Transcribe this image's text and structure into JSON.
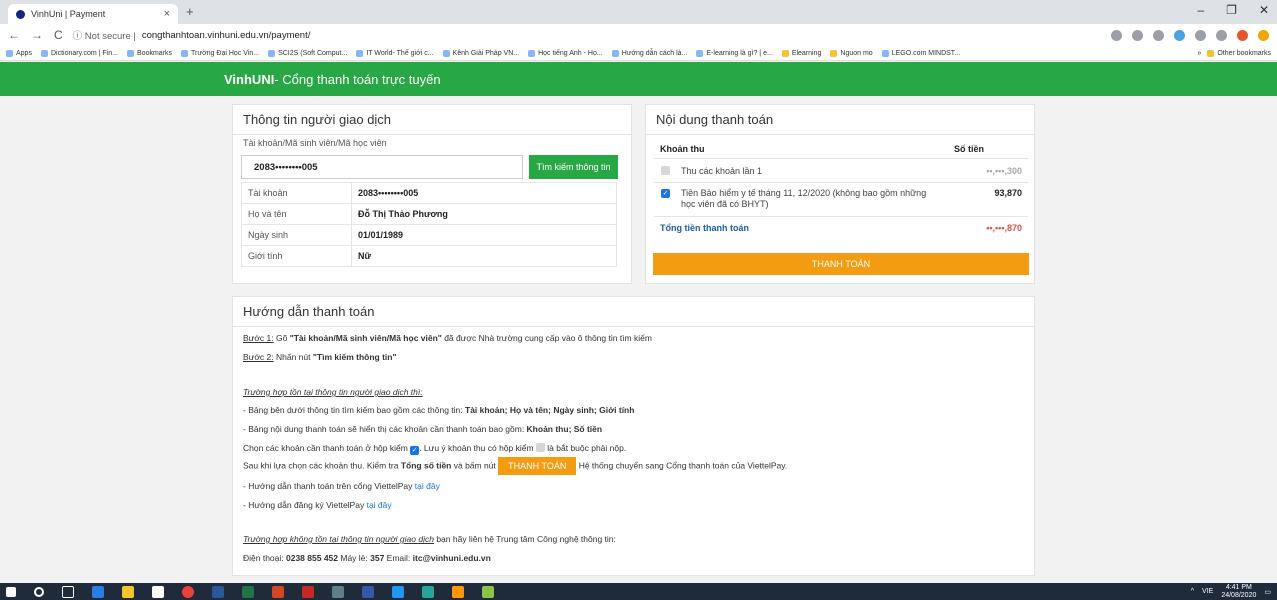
{
  "browser": {
    "tab_title": "VinhUni | Payment",
    "tab_close": "×",
    "new_tab": "+",
    "win_min": "–",
    "win_max": "❐",
    "win_close": "✕",
    "nav_back": "←",
    "nav_forward": "→",
    "nav_reload": "C",
    "security": "ⓘ Not secure |",
    "url": "congthanhtoan.vinhuni.edu.vn/payment/"
  },
  "bookmarks": {
    "items": [
      "Apps",
      "Dictionary.com | Fin...",
      "Bookmarks",
      "Trường Đại Học Vin...",
      "SCI2S (Soft Comput...",
      "IT World- Thế giới c...",
      "Kênh Giải Pháp VN...",
      "Học tiếng Anh - Họ...",
      "Hướng dẫn cách là...",
      "E-learning là gì? | e...",
      "Elearning",
      "Nguon mo",
      "LEGO.com MINDST..."
    ],
    "more": "»",
    "other": "Other bookmarks"
  },
  "header": {
    "brand": "VinhUNI",
    "title": " - Cổng thanh toán trực tuyến"
  },
  "user_panel": {
    "title": "Thông tin người giao dịch",
    "account_label": "Tài khoản/Mã sinh viên/Mã học viên",
    "account_value": "2083••••••••005",
    "search_button": "Tìm kiếm thông tin",
    "rows": [
      {
        "key": "Tài khoản",
        "value": "2083••••••••005"
      },
      {
        "key": "Họ và tên",
        "value": "Đỗ Thị Thảo Phương"
      },
      {
        "key": "Ngày sinh",
        "value": "01/01/1989"
      },
      {
        "key": "Giới tính",
        "value": "Nữ"
      }
    ]
  },
  "pay_panel": {
    "title": "Nội dung thanh toán",
    "col_item": "Khoản thu",
    "col_amount": "Số tiền",
    "items": [
      {
        "label": "Thu các khoản lần 1",
        "amount": "••,•••,300",
        "checked": "false"
      },
      {
        "label": "Tiền Bảo hiểm y tế tháng 11, 12/2020 (không bao gồm những học viên đã có BHYT)",
        "amount": "93,870",
        "checked": "true"
      }
    ],
    "total_label": "Tổng tiền thanh toán",
    "total_value": "••,•••,870",
    "pay_button": "THANH TOÁN"
  },
  "guide": {
    "title": "Hướng dẫn thanh toán",
    "step1_label": "Bước 1:",
    "step1_pre": " Gõ ",
    "step1_bold": "\"Tài khoản/Mã sinh viên/Mã học viên\"",
    "step1_post": " đã được Nhà trường cung cấp vào ô thông tin tìm kiếm",
    "step2_label": "Bước 2:",
    "step2_pre": " Nhấn nút ",
    "step2_bold": "\"Tìm kiếm thông tin\"",
    "case1_heading": "Trường hợp tồn tại thông tin người giao dịch thì:",
    "case1_l1_pre": "- Bảng bên dưới thông tin tìm kiếm bao gồm các thông tin: ",
    "case1_l1_bold": "Tài khoản; Họ và tên; Ngày sinh; Giới tính",
    "case1_l2_pre": "- Bảng nội dung thanh toán sẽ hiển thị các khoản cần thanh toán bao gồm: ",
    "case1_l2_bold": "Khoản thu; Số tiền",
    "case1_l3_pre": "Chọn các khoản cần thanh toán ở hộp kiểm ",
    "case1_l3_mid": ". Lưu ý khoản thu có hộp kiểm ",
    "case1_l3_post": " là bắt buộc phải nộp.",
    "case1_l4_pre": "Sau khi lựa chọn các khoản thu. Kiểm tra ",
    "case1_l4_bold": "Tổng số tiền",
    "case1_l4_mid": " và bấm nút ",
    "case1_l4_btn": "THANH TOÁN",
    "case1_l4_post": " Hệ thống chuyển sang Cổng thanh toán của ViettelPay.",
    "case1_l5_pre": "- Hướng dẫn thanh toán trên cổng ViettelPay ",
    "case1_l5_link": "tại đây",
    "case1_l6_pre": "- Hướng dẫn đăng ký ViettelPay ",
    "case1_l6_link": "tại đây",
    "case2_heading": "Trường hợp không tồn tại thông tin người giao dịch",
    "case2_post": " bạn hãy liên hệ Trung tâm Công nghệ thông tin:",
    "contact_phone_label": "Điện thoại: ",
    "contact_phone": "0238 855 452",
    "contact_ext_label": " Máy lẻ: ",
    "contact_ext": "357",
    "contact_email_label": " Email: ",
    "contact_email": "itc@vinhuni.edu.vn"
  },
  "taskbar": {
    "lang": "VIE",
    "time": "4:41 PM",
    "date": "24/08/2020"
  }
}
